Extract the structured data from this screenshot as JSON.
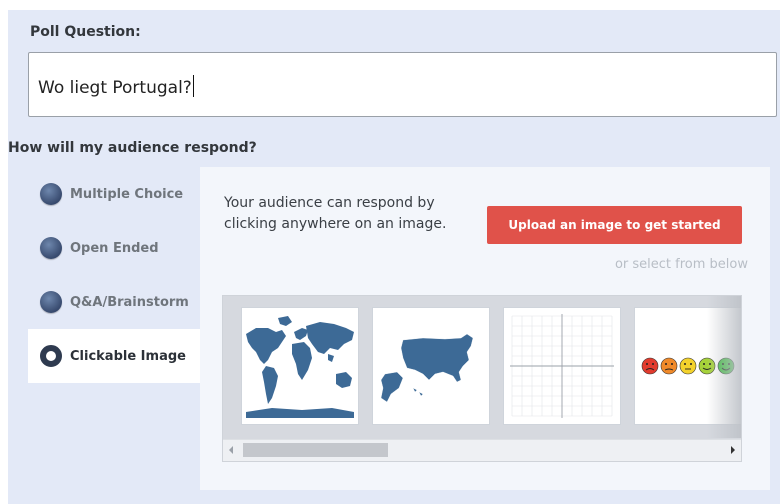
{
  "poll": {
    "question_label": "Poll Question:",
    "question_value": "Wo liegt Portugal?"
  },
  "respond": {
    "label": "How will my audience respond?",
    "types": [
      {
        "label": "Multiple Choice",
        "active": false
      },
      {
        "label": "Open Ended",
        "active": false
      },
      {
        "label": "Q&A/Brainstorm",
        "active": false
      },
      {
        "label": "Clickable Image",
        "active": true
      }
    ]
  },
  "clickable_image": {
    "description": "Your audience can respond by clicking anywhere on an image.",
    "upload_button": "Upload an image to get started",
    "or_select": "or select from below",
    "thumbnails": [
      {
        "name": "world-map",
        "icon": "world-map-icon"
      },
      {
        "name": "usa-map",
        "icon": "usa-map-icon"
      },
      {
        "name": "coordinate-grid",
        "icon": "grid-icon"
      },
      {
        "name": "smiley-scale",
        "icon": "smiley-scale-icon"
      }
    ]
  },
  "colors": {
    "accent": "#e0524a",
    "panel_bg": "#e3e9f7",
    "content_bg": "#f3f6fb",
    "map_blue": "#3d6a96"
  }
}
